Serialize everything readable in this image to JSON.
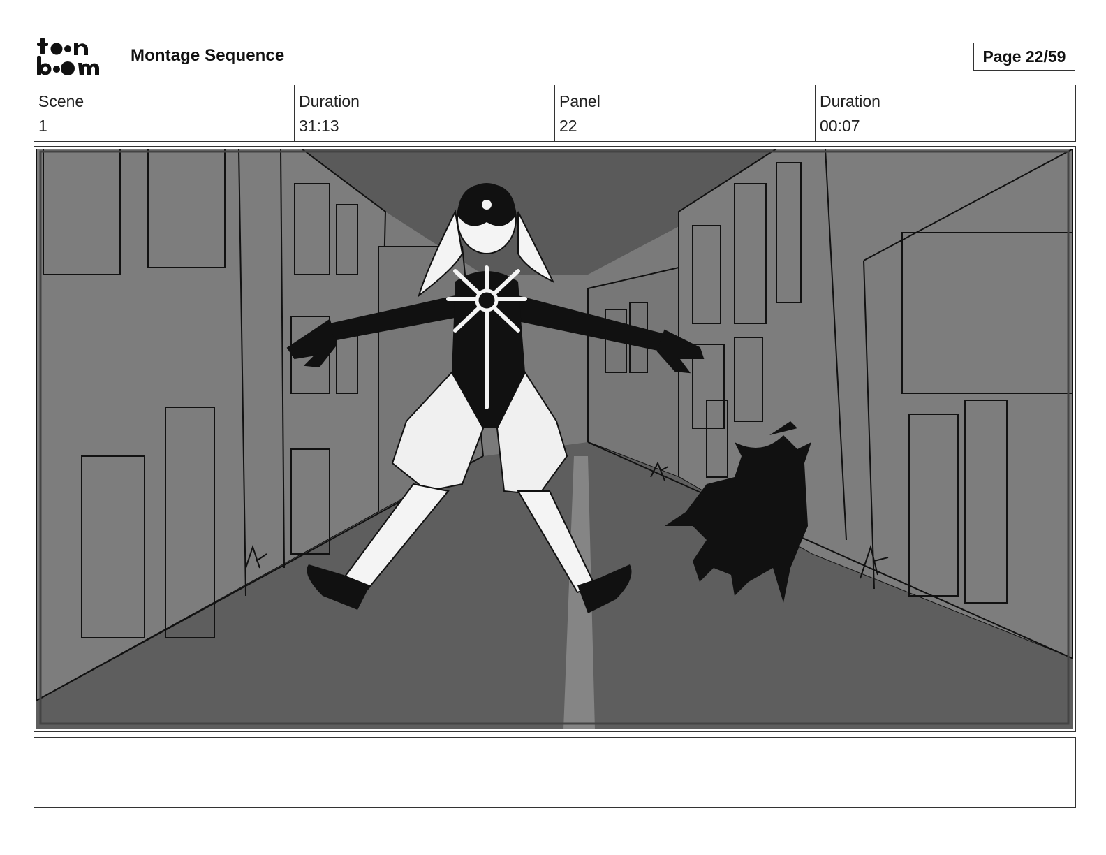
{
  "header": {
    "logo_text": "toon boom",
    "title": "Montage Sequence",
    "page": "Page 22/59"
  },
  "info": {
    "scene_label": "Scene",
    "scene_value": "1",
    "scene_duration_label": "Duration",
    "scene_duration_value": "31:13",
    "panel_label": "Panel",
    "panel_value": "22",
    "panel_duration_label": "Duration",
    "panel_duration_value": "00:07"
  },
  "panel": {
    "image_icon": "storyboard-drawing-icon"
  },
  "notes": {
    "text": ""
  }
}
